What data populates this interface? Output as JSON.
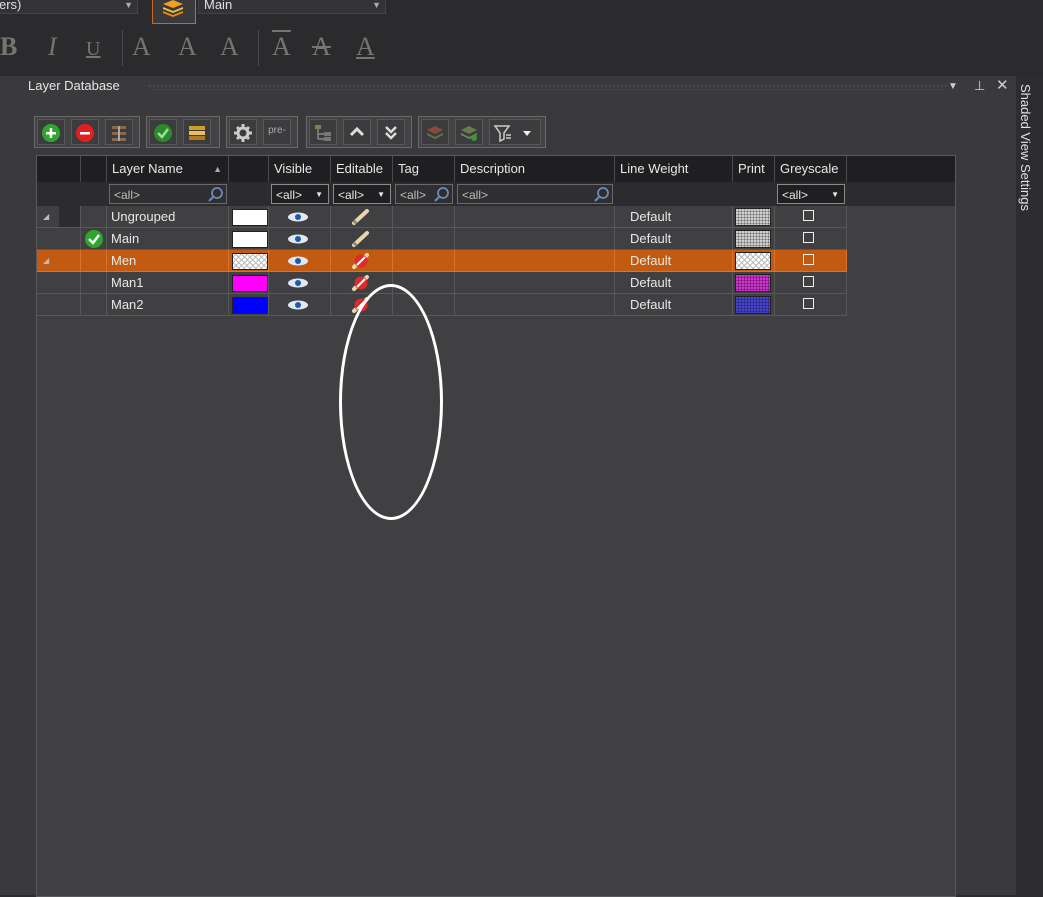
{
  "topbar": {
    "combo_left_text": "ers)",
    "combo_right_text": "Main",
    "format_buttons": [
      "B",
      "I",
      "U",
      "A",
      "A",
      "A",
      "A",
      "A",
      "A"
    ]
  },
  "panel": {
    "title": "Layer Database",
    "pin_icon": "pin-icon",
    "close_icon": "close-icon",
    "menu_icon": "dropdown-icon"
  },
  "side_tab": {
    "label": "Shaded View Settings"
  },
  "toolbar": {
    "buttons": [
      "add-layer",
      "delete-layer",
      "merge-layer",
      "set-current",
      "layer-properties",
      "settings",
      "pre",
      "new-group",
      "move-up",
      "move-down",
      "isolate",
      "show-all",
      "filter"
    ],
    "pre_label": "pre-"
  },
  "grid": {
    "columns": [
      "Layer Name",
      "Visible",
      "Editable",
      "Tag",
      "Description",
      "Line Weight",
      "Print",
      "Greyscale"
    ],
    "filters": {
      "layer_name": "<all>",
      "visible": "<all>",
      "editable": "<all>",
      "tag": "<all>",
      "description": "<all>",
      "greyscale": "<all>"
    },
    "rows": [
      {
        "name": "Ungrouped",
        "expander": "◢",
        "current": false,
        "color": "#ffffff",
        "color_pattern": false,
        "visible": true,
        "editable": true,
        "line_weight": "Default",
        "print_color": "#cfcfcf",
        "greyscale": false,
        "selected": false
      },
      {
        "name": "Main",
        "expander": "",
        "current": true,
        "color": "#ffffff",
        "color_pattern": false,
        "visible": true,
        "editable": true,
        "line_weight": "Default",
        "print_color": "#cfcfcf",
        "greyscale": false,
        "selected": false
      },
      {
        "name": "Men",
        "expander": "◢",
        "current": false,
        "color": "#ffffff",
        "color_pattern": true,
        "visible": true,
        "editable": false,
        "line_weight": "Default",
        "print_color": "#ffffff",
        "greyscale": false,
        "selected": true
      },
      {
        "name": "Man1",
        "expander": "",
        "current": false,
        "color": "#ff00ff",
        "color_pattern": false,
        "visible": true,
        "editable": false,
        "line_weight": "Default",
        "print_color": "#cc33cc",
        "greyscale": false,
        "selected": false
      },
      {
        "name": "Man2",
        "expander": "",
        "current": false,
        "color": "#0000ff",
        "color_pattern": false,
        "visible": true,
        "editable": false,
        "line_weight": "Default",
        "print_color": "#4444cc",
        "greyscale": false,
        "selected": false
      }
    ]
  },
  "colors": {
    "accent": "#c25a0f",
    "annotation_circle": "#ffffff"
  }
}
